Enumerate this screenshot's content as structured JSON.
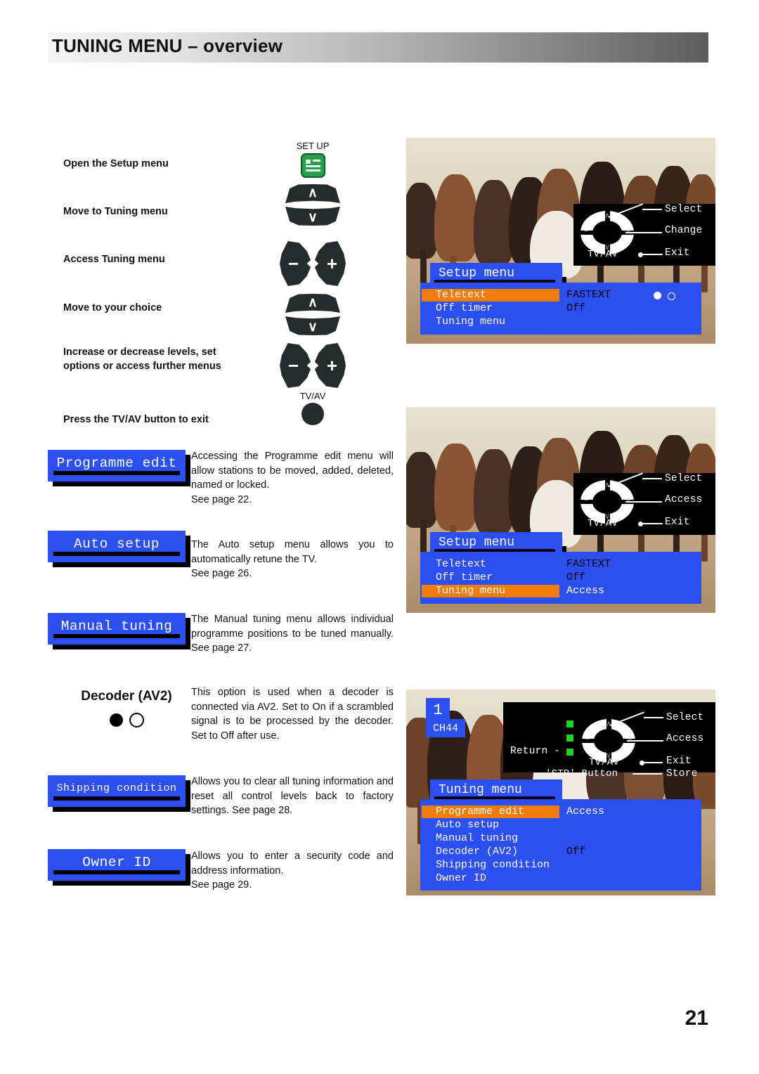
{
  "header": {
    "title_main": "TUNING MENU",
    "title_sep": " – ",
    "title_sub": "overview"
  },
  "page_number": "21",
  "steps": [
    {
      "text": "Open the Setup menu",
      "key": "setup-key",
      "key_label": "SET UP"
    },
    {
      "text": "Move to Tuning menu",
      "key": "up-down",
      "key_label": ""
    },
    {
      "text": "Access Tuning menu",
      "key": "minus-plus",
      "key_label": ""
    },
    {
      "text": "Move to your choice",
      "key": "up-down",
      "key_label": ""
    },
    {
      "text": "Increase or decrease levels, set options or access further menus",
      "key": "minus-plus",
      "key_label": ""
    },
    {
      "text": "Press the TV/AV button to exit",
      "key": "round",
      "key_label": "TV/AV"
    }
  ],
  "entries": [
    {
      "chip": "Programme edit",
      "body": "Accessing the Programme edit menu will allow stations to be moved, added, deleted, named or locked.",
      "page_ref": "See page 22."
    },
    {
      "chip": "Auto setup",
      "body": "The Auto setup menu allows you to automatically retune the TV.",
      "page_ref": "See page 26."
    },
    {
      "chip": "Manual tuning",
      "body": "The Manual tuning menu allows individual programme positions to be tuned manually. See page 27.",
      "page_ref": ""
    },
    {
      "chip": "Shipping condition",
      "body": "Allows you to clear all tuning information and reset all control levels back to factory settings. See page 28.",
      "page_ref": ""
    },
    {
      "chip": "Owner ID",
      "body": "Allows you to enter a security code and address information.",
      "page_ref": "See page 29."
    }
  ],
  "decoder": {
    "title": "Decoder (AV2)",
    "body": "This option is used when a decoder is connected via AV2. Set to On if a scrambled signal is to be processed by the decoder. Set to Off after use."
  },
  "tv_panels": [
    {
      "id": "panel-setup-teletext",
      "hint": {
        "rows": [
          {
            "label": "Select",
            "source": "up-arrow"
          },
          {
            "label": "Change",
            "source": "plus"
          },
          {
            "label": "Exit",
            "source": "TV/AV"
          }
        ],
        "tvav_label": "TV/AV"
      },
      "menu_title": "Setup menu",
      "rows": [
        {
          "label": "Teletext",
          "value": "FASTEXT",
          "highlight": true,
          "value_dark": true
        },
        {
          "label": "Off timer",
          "value": "Off",
          "highlight": false,
          "value_dark": true
        },
        {
          "label": "Tuning menu",
          "value": "",
          "highlight": false,
          "value_dark": false
        }
      ],
      "toggle_dots": true
    },
    {
      "id": "panel-setup-tuning",
      "hint": {
        "rows": [
          {
            "label": "Select",
            "source": "up-arrow"
          },
          {
            "label": "Access",
            "source": "plus"
          },
          {
            "label": "Exit",
            "source": "TV/AV"
          }
        ],
        "tvav_label": "TV/AV"
      },
      "menu_title": "Setup menu",
      "rows": [
        {
          "label": "Teletext",
          "value": "FASTEXT",
          "highlight": false,
          "value_dark": true
        },
        {
          "label": "Off timer",
          "value": "Off",
          "highlight": false,
          "value_dark": true
        },
        {
          "label": "Tuning menu",
          "value": "Access",
          "highlight": true,
          "value_dark": false
        }
      ],
      "toggle_dots": false
    },
    {
      "id": "panel-tuning-menu",
      "channel": {
        "number": "1",
        "name": "CH44"
      },
      "hint": {
        "return_label": "Return -",
        "str_label": "'STR' Button",
        "store_label": "Store",
        "rows": [
          {
            "label": "Select",
            "source": "up-arrow"
          },
          {
            "label": "Access",
            "source": "plus"
          },
          {
            "label": "Exit",
            "source": "TV/AV"
          }
        ],
        "tvav_label": "TV/AV"
      },
      "menu_title": "Tuning menu",
      "rows": [
        {
          "label": "Programme edit",
          "value": "Access",
          "highlight": true,
          "value_dark": false
        },
        {
          "label": "Auto setup",
          "value": "",
          "highlight": false,
          "value_dark": false
        },
        {
          "label": "Manual tuning",
          "value": "",
          "highlight": false,
          "value_dark": false
        },
        {
          "label": "Decoder (AV2)",
          "value": "Off",
          "highlight": false,
          "value_dark": true
        },
        {
          "label": "Shipping condition",
          "value": "",
          "highlight": false,
          "value_dark": false
        },
        {
          "label": "Owner ID",
          "value": "",
          "highlight": false,
          "value_dark": false
        }
      ],
      "toggle_dots": false
    }
  ],
  "colors": {
    "osd_blue": "#2b4ff0",
    "osd_highlight": "#f07d0a",
    "setup_key_green": "#2a9d4e",
    "key_dark": "#262b2b",
    "green_led": "#19d719"
  }
}
